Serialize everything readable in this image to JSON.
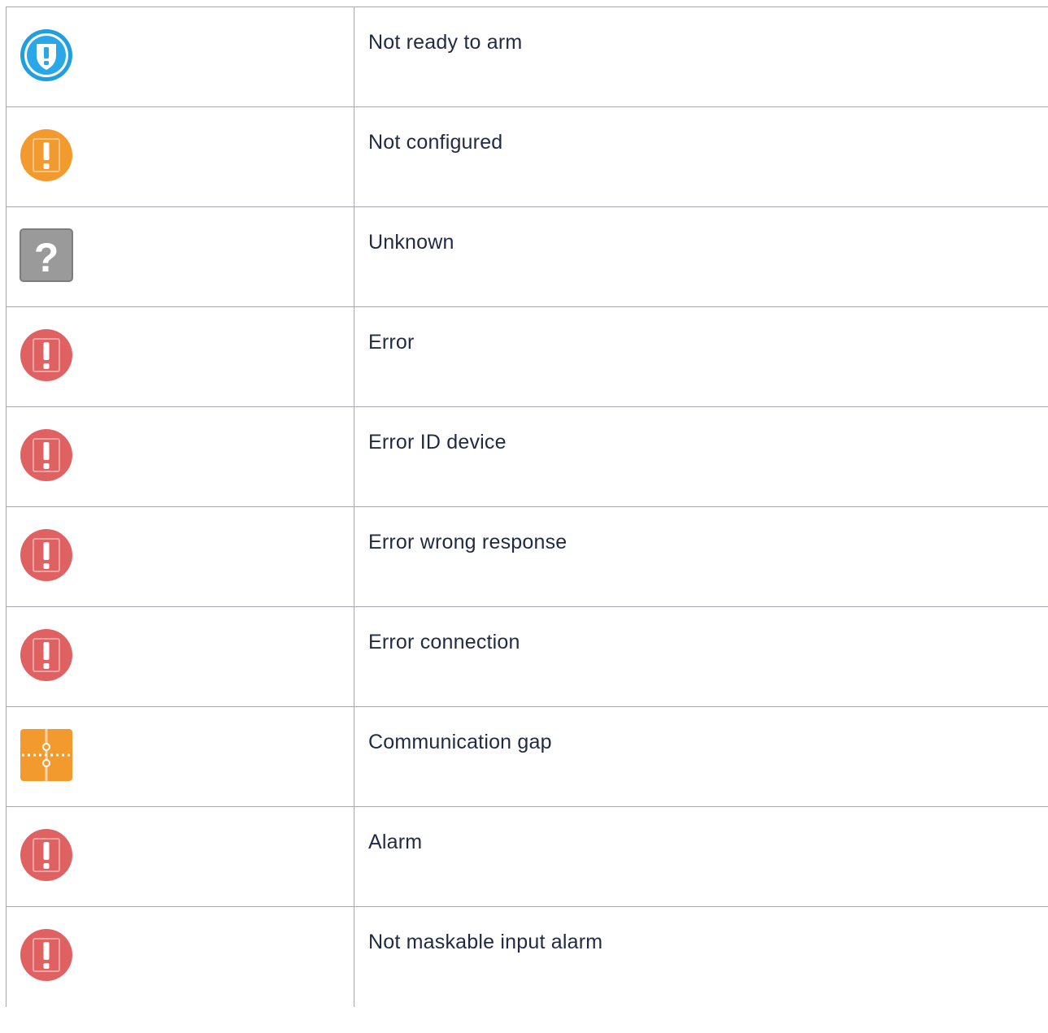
{
  "rows": [
    {
      "icon": "shield-exclamation-blue-icon",
      "color": "#1f9fe0",
      "label": "Not ready to arm"
    },
    {
      "icon": "exclamation-orange-icon",
      "color": "#f39a2e",
      "label": "Not configured"
    },
    {
      "icon": "question-gray-icon",
      "color": "#9a9a9a",
      "label": "Unknown"
    },
    {
      "icon": "exclamation-red-icon",
      "color": "#df6161",
      "label": "Error"
    },
    {
      "icon": "exclamation-red-icon",
      "color": "#df6161",
      "label": "Error ID device"
    },
    {
      "icon": "exclamation-red-icon",
      "color": "#df6161",
      "label": "Error wrong response"
    },
    {
      "icon": "exclamation-red-icon",
      "color": "#df6161",
      "label": "Error connection"
    },
    {
      "icon": "communication-gap-orange-icon",
      "color": "#f39a2e",
      "label": "Communication gap"
    },
    {
      "icon": "exclamation-red-icon",
      "color": "#df6161",
      "label": "Alarm"
    },
    {
      "icon": "exclamation-red-icon",
      "color": "#df6161",
      "label": "Not maskable input alarm"
    }
  ]
}
